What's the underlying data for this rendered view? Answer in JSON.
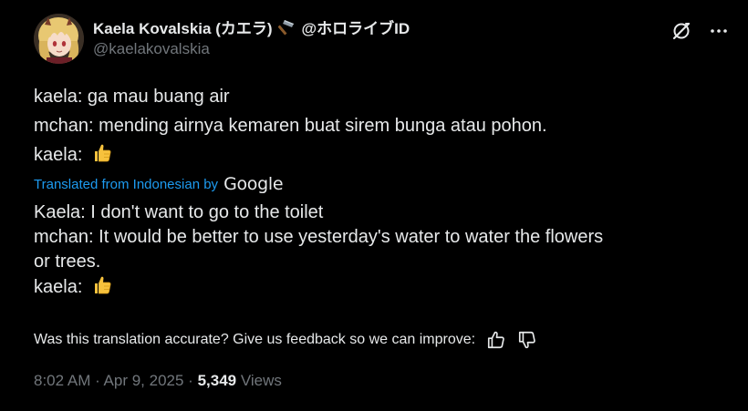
{
  "author": {
    "display_name": "Kaela Kovalskia (カエラ)",
    "affiliation": "@ホロライブID",
    "handle": "@kaelakovalskia",
    "avatar_icon": "avatar-image",
    "badge_icon": "hammer-icon"
  },
  "tweet": {
    "lines": [
      {
        "text": "kaela: ga mau buang air",
        "emoji": ""
      },
      {
        "text": "mchan: mending airnya kemaren buat sirem bunga atau pohon.",
        "emoji": ""
      },
      {
        "text": "kaela:",
        "emoji": "thumbs-up"
      }
    ]
  },
  "translation": {
    "label": "Translated from Indonesian by",
    "provider": "Google",
    "lines": [
      "Kaela: I don't want to go to the toilet",
      "mchan: It would be better to use yesterday's water to water the flowers",
      "or trees.",
      "kaela:"
    ],
    "last_emoji": "thumbs-up"
  },
  "feedback": {
    "question": "Was this translation accurate? Give us feedback so we can improve:",
    "up_icon": "thumbs-up-outline-icon",
    "down_icon": "thumbs-down-outline-icon"
  },
  "meta": {
    "time": "8:02 AM",
    "sep1": " · ",
    "date": "Apr 9, 2025",
    "sep2": " · ",
    "views_count": "5,349",
    "views_label": " Views"
  },
  "colors": {
    "background": "#000000",
    "text": "#e7e9ea",
    "muted": "#71767b",
    "link": "#1d9bf0",
    "emoji_yellow": "#f7c23d"
  }
}
